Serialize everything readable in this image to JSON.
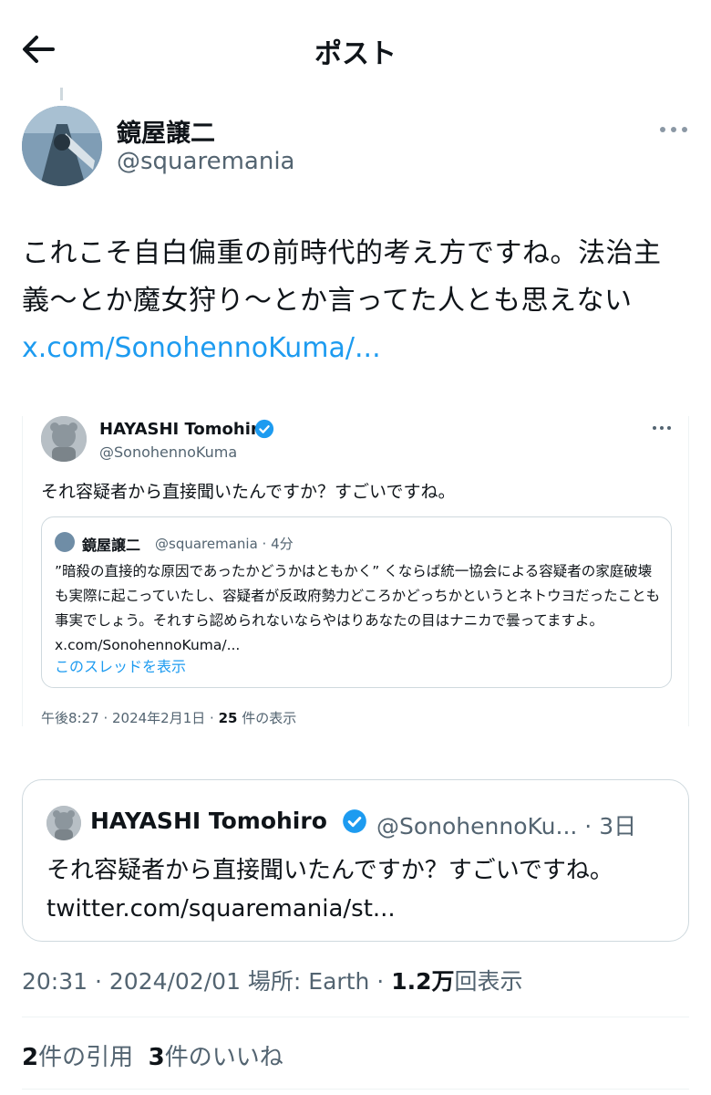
{
  "header": {
    "title": "ポスト"
  },
  "post": {
    "author_name": "鏡屋譲二",
    "author_handle": "@squaremania",
    "text": "これこそ自白偏重の前時代的考え方ですね。法治主義〜とか魔女狩り〜とか言ってた人とも思えない",
    "link": "x.com/SonohennoKuma/..."
  },
  "embedded_post": {
    "author_name": "HAYASHI Tomohiro",
    "author_handle": "@SonohennoKuma",
    "text": "それ容疑者から直接聞いたんですか？すごいですね。",
    "quoted": {
      "author_name": "鏡屋譲二",
      "meta": "@squaremania · 4分",
      "text": "”暗殺の直接的な原因であったかどうかはともかく” くならば統一協会による容疑者の家庭破壊も実際に起こっていたし、容疑者が反政府勢力どころかどっちかというとネトウヨだったことも事実でしょう。それすら認められないならやはりあなたの目はナニカで曇ってますよ。x.com/SonohennoKuma/...",
      "show_thread": "このスレッドを表示"
    },
    "footer_time": "午後8:27 · 2024年2月1日 · ",
    "footer_views": "25",
    "footer_views_label": " 件の表示"
  },
  "quote_card": {
    "author_name": "HAYASHI Tomohiro",
    "meta": "@SonohennoKu... · 3日",
    "text": "それ容疑者から直接聞いたんですか？すごいですね。twitter.com/squaremania/st..."
  },
  "meta": {
    "time": "20:31 · 2024/02/01 場所: Earth · ",
    "views": "1.2万",
    "views_label": "回表示"
  },
  "stats": {
    "quotes_count": "2",
    "quotes_label": "件の引用",
    "likes_count": "3",
    "likes_label": "件のいいね"
  },
  "colors": {
    "link": "#1d9bf0",
    "muted": "#536471",
    "verified": "#1d9bf0"
  },
  "icons": [
    "back-arrow-icon",
    "more-icon",
    "verified-icon"
  ]
}
